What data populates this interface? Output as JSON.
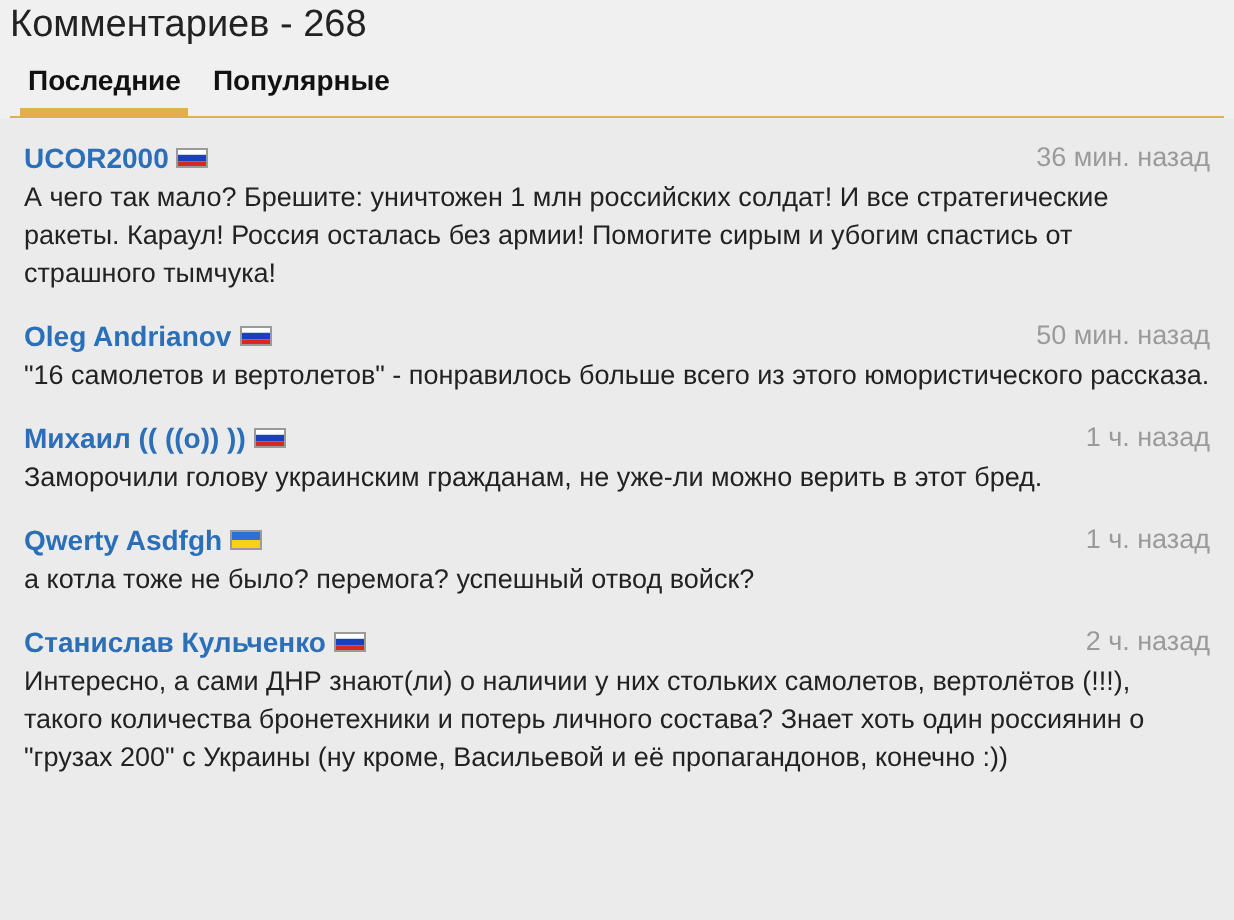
{
  "title": "Комментариев - 268",
  "tabs": [
    {
      "label": "Последние",
      "selected": true
    },
    {
      "label": "Популярные",
      "selected": false
    }
  ],
  "comments": [
    {
      "author": "UCOR2000",
      "flag": {
        "kind": "ru"
      },
      "time": "36 мин. назад",
      "text": "А чего так мало? Брешите: уничтожен 1 млн российских солдат! И все стратегические ракеты. Караул! Россия осталась без армии! Помогите сирым и убогим спастись от страшного тымчука!"
    },
    {
      "author": "Oleg Andrianov",
      "flag": {
        "kind": "ru"
      },
      "time": "50 мин. назад",
      "text": "\"16 самолетов и вертолетов\" - понравилось больше всего из этого юмористического рассказа."
    },
    {
      "author": "Михаил (( ((o)) ))",
      "flag": {
        "kind": "ru"
      },
      "time": "1 ч. назад",
      "text": "Заморочили голову украинским гражданам, не уже-ли можно верить в этот бред."
    },
    {
      "author": "Qwerty Asdfgh",
      "flag": {
        "kind": "ua"
      },
      "time": "1 ч. назад",
      "text": "а котла тоже не было? перемога? успешный отвод войск?"
    },
    {
      "author": "Станислав Кульченко",
      "flag": {
        "kind": "ru"
      },
      "time": "2 ч. назад",
      "text": "Интересно, а сами ДНР знают(ли) о наличии у них стольких самолетов, вертолётов (!!!), такого количества бронетехники и потерь личного состава? Знает хоть один россиянин о \"грузах 200\" с Украины (ну кроме, Васильевой и её пропагандонов, конечно :))"
    }
  ]
}
